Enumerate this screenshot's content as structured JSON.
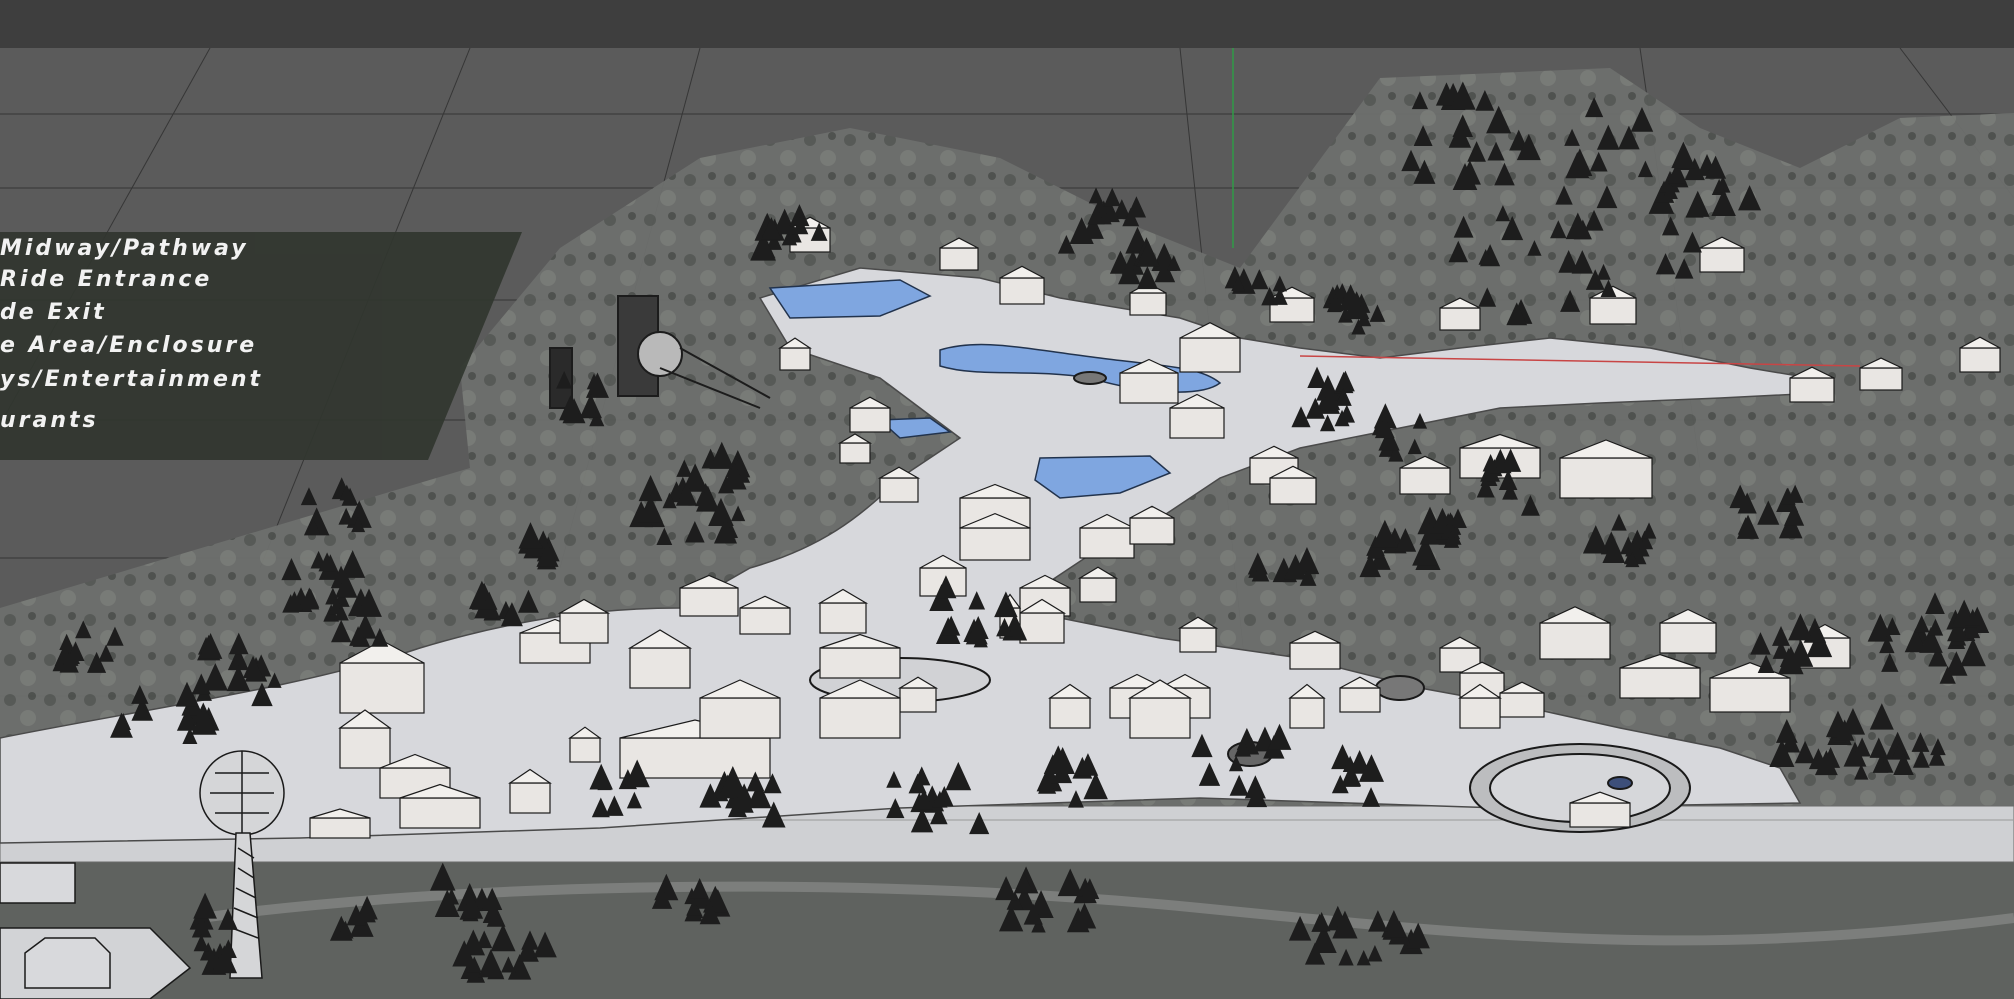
{
  "legend": {
    "items": [
      {
        "label": "Midway/Pathway",
        "icon": "midway-pathway"
      },
      {
        "label": "Ride Entrance",
        "icon": "ride-entrance"
      },
      {
        "label": "de Exit",
        "icon": "ride-exit"
      },
      {
        "label": "e Area/Enclosure",
        "icon": "area-enclosure"
      },
      {
        "label": "ys/Entertainment",
        "icon": "shows-entertainment"
      },
      {
        "label": "urants",
        "icon": "restaurants"
      }
    ]
  },
  "colors": {
    "toolbar": "#3e3e3e",
    "viewport_bg": "#5b5b5b",
    "ground": "#d7d8dc",
    "water": "#7fa6e0",
    "tree": "#1d1d1d",
    "building": "#e9e6e3",
    "legend_bg": "#31362f",
    "axis_green": "#2f9b46",
    "axis_red": "#c84545"
  }
}
